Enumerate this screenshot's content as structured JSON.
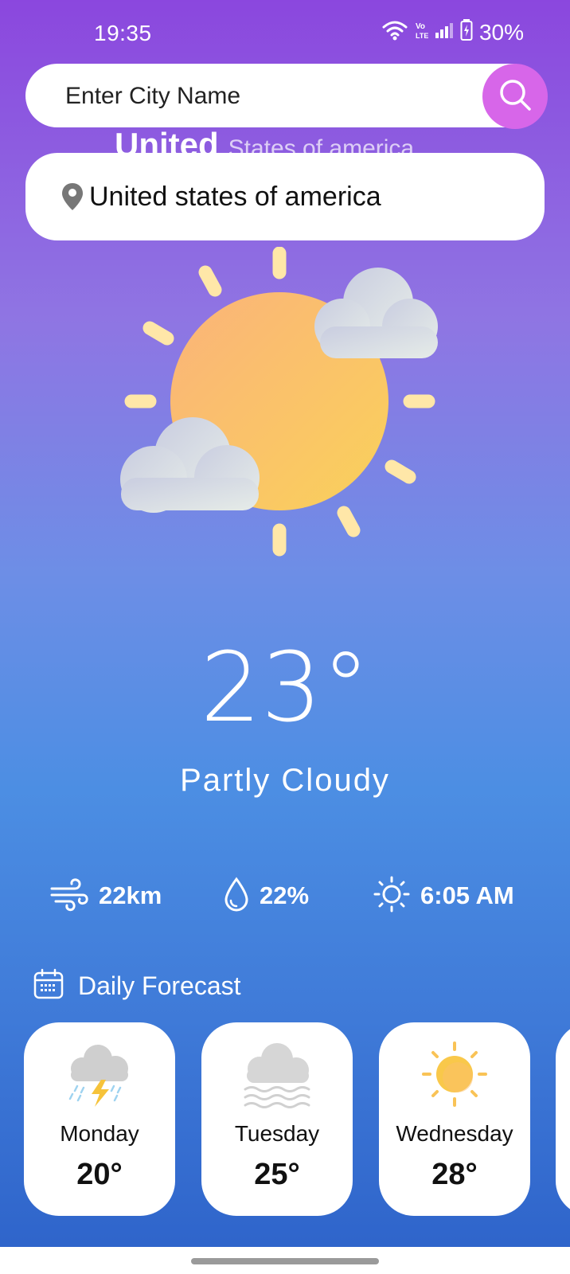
{
  "status_bar": {
    "time": "19:35",
    "battery_percent": "30%",
    "icons": [
      "wifi-icon",
      "volte-icon",
      "signal-icon",
      "battery-charging-icon"
    ]
  },
  "search": {
    "placeholder": "Enter City Name",
    "value": "",
    "button_icon": "search-icon",
    "button_color": "#d766e9"
  },
  "location": {
    "city": "United",
    "country": "States of america"
  },
  "suggestion": {
    "icon": "location-pin-icon",
    "text": "United states of america"
  },
  "current": {
    "icon": "partly-cloudy-icon",
    "temperature": "23°",
    "condition": "Partly Cloudy"
  },
  "stats": [
    {
      "icon": "wind-icon",
      "value": "22km"
    },
    {
      "icon": "humidity-drop-icon",
      "value": "22%"
    },
    {
      "icon": "sunrise-sun-icon",
      "value": "6:05 AM"
    }
  ],
  "forecast": {
    "icon": "calendar-icon",
    "label": "Daily Forecast",
    "days": [
      {
        "day": "Monday",
        "temp": "20°",
        "icon": "thunderstorm-icon"
      },
      {
        "day": "Tuesday",
        "temp": "25°",
        "icon": "mist-icon"
      },
      {
        "day": "Wednesday",
        "temp": "28°",
        "icon": "sunny-icon"
      }
    ]
  },
  "theme": {
    "gradient_top": "#8b47de",
    "gradient_bottom": "#2d62c9",
    "sun_color": "#f9c356",
    "ray_color": "#ffe7a8"
  }
}
